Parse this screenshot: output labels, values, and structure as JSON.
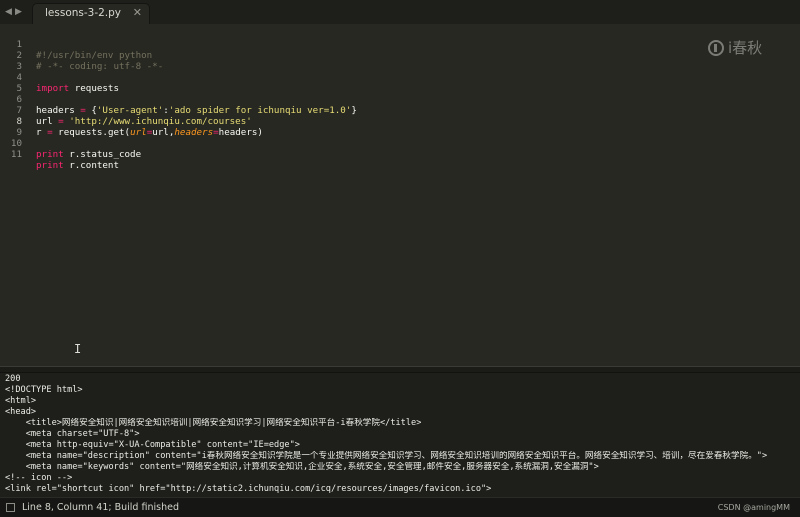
{
  "tabbar": {
    "back_arrow": "◀",
    "forward_arrow": "▶",
    "tab_label": "lessons-3-2.py",
    "tab_close": "✕"
  },
  "watermark": {
    "text": "i春秋"
  },
  "editor": {
    "lines": [
      {
        "n": "1",
        "text": "#!/usr/bin/env python"
      },
      {
        "n": "2",
        "text": "# -*- coding: utf-8 -*-"
      },
      {
        "n": "3",
        "text": ""
      },
      {
        "n": "4",
        "text": "import requests"
      },
      {
        "n": "5",
        "text": ""
      },
      {
        "n": "6",
        "text": "headers = {'User-agent':'ado spider for ichunqiu ver=1.0'}"
      },
      {
        "n": "7",
        "text": "url = 'http://www.ichunqiu.com/courses'"
      },
      {
        "n": "8",
        "text": "r = requests.get(url=url,headers=headers)"
      },
      {
        "n": "9",
        "text": ""
      },
      {
        "n": "10",
        "text": "print r.status_code"
      },
      {
        "n": "11",
        "text": "print r.content"
      }
    ],
    "tokens": {
      "l1": "#!/usr/bin/env python",
      "l2": "# -*- coding: utf-8 -*-",
      "l4_kw": "import",
      "l4_rest": " requests",
      "l6_a": "headers ",
      "l6_eq": "=",
      "l6_b": " {",
      "l6_s1": "'User-agent'",
      "l6_c": ":",
      "l6_s2": "'ado spider for ichunqiu ver=1.0'",
      "l6_d": "}",
      "l7_a": "url ",
      "l7_eq": "=",
      "l7_b": " ",
      "l7_s": "'http://www.ichunqiu.com/courses'",
      "l8_a": "r ",
      "l8_eq": "=",
      "l8_b": " requests.get(",
      "l8_arg1": "url",
      "l8_eq2": "=",
      "l8_c": "url,",
      "l8_arg2": "headers",
      "l8_eq3": "=",
      "l8_d": "headers)",
      "l10_kw": "print",
      "l10_rest": " r.status_code",
      "l11_kw": "print",
      "l11_rest": " r.content"
    }
  },
  "cursor_glyph": "I",
  "output": {
    "lines": [
      "200",
      "<!DOCTYPE html>",
      "<html>",
      "<head>",
      "    <title>网络安全知识|网络安全知识培训|网络安全知识学习|网络安全知识平台-i春秋学院</title>",
      "    <meta charset=\"UTF-8\">",
      "    <meta http-equiv=\"X-UA-Compatible\" content=\"IE=edge\">",
      "    <meta name=\"description\" content=\"i春秋网络安全知识学院是一个专业提供网络安全知识学习、网络安全知识培训的网络安全知识平台。网络安全知识学习、培训，尽在爱春秋学院。\">",
      "    <meta name=\"keywords\" content=\"网络安全知识,计算机安全知识,企业安全,系统安全,安全管理,邮件安全,服务器安全,系统漏洞,安全漏洞\">",
      "<!-- icon -->",
      "<link rel=\"shortcut icon\" href=\"http://static2.ichunqiu.com/icq/resources/images/favicon.ico\">"
    ]
  },
  "statusbar": {
    "text": "Line 8, Column 41; Build finished",
    "credit": "CSDN @amingMM"
  }
}
